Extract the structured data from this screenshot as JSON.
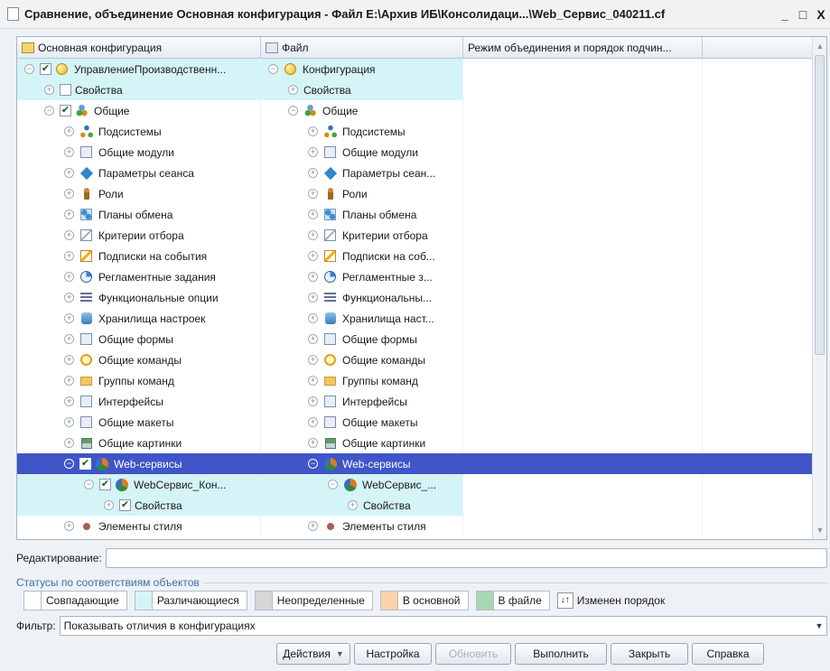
{
  "window": {
    "title": "Сравнение, объединение Основная конфигурация - Файл E:\\Архив ИБ\\Консолидаци...\\Web_Сервис_040211.cf",
    "minimize": "_",
    "maximize": "□",
    "close": "X"
  },
  "grid": {
    "columns": [
      "Основная конфигурация",
      "Файл",
      "Режим объединения и порядок подчин...",
      ""
    ],
    "rows": [
      {
        "indent_main": 0,
        "toggle": "−",
        "check": "checked",
        "icon": "config-icon",
        "main": "УправлениеПроизводственн...",
        "indent_file": 0,
        "file_toggle": "−",
        "file_icon": "config-icon",
        "file": "Конфигурация",
        "state": "diff"
      },
      {
        "indent_main": 1,
        "toggle": "+",
        "check": "unchecked",
        "icon": "",
        "main": "Свойства",
        "indent_file": 1,
        "file_toggle": "+",
        "file_icon": "",
        "file": "Свойства",
        "state": "diff"
      },
      {
        "indent_main": 1,
        "toggle": "−",
        "check": "checked",
        "icon": "common-icon",
        "main": "Общие",
        "indent_file": 1,
        "file_toggle": "−",
        "file_icon": "common-icon",
        "file": "Общие",
        "state": ""
      },
      {
        "indent_main": 2,
        "toggle": "+",
        "check": "",
        "icon": "subsystems-icon",
        "main": "Подсистемы",
        "indent_file": 2,
        "file_toggle": "+",
        "file_icon": "subsystems-icon",
        "file": "Подсистемы",
        "state": ""
      },
      {
        "indent_main": 2,
        "toggle": "+",
        "check": "",
        "icon": "modules-icon",
        "main": "Общие модули",
        "indent_file": 2,
        "file_toggle": "+",
        "file_icon": "modules-icon",
        "file": "Общие модули",
        "state": ""
      },
      {
        "indent_main": 2,
        "toggle": "+",
        "check": "",
        "icon": "session-params-icon",
        "main": "Параметры сеанса",
        "indent_file": 2,
        "file_toggle": "+",
        "file_icon": "session-params-icon",
        "file": "Параметры сеан...",
        "state": ""
      },
      {
        "indent_main": 2,
        "toggle": "+",
        "check": "",
        "icon": "roles-icon",
        "main": "Роли",
        "indent_file": 2,
        "file_toggle": "+",
        "file_icon": "roles-icon",
        "file": "Роли",
        "state": ""
      },
      {
        "indent_main": 2,
        "toggle": "+",
        "check": "",
        "icon": "exchange-plans-icon",
        "main": "Планы обмена",
        "indent_file": 2,
        "file_toggle": "+",
        "file_icon": "exchange-plans-icon",
        "file": "Планы обмена",
        "state": ""
      },
      {
        "indent_main": 2,
        "toggle": "+",
        "check": "",
        "icon": "filter-criteria-icon",
        "main": "Критерии отбора",
        "indent_file": 2,
        "file_toggle": "+",
        "file_icon": "filter-criteria-icon",
        "file": "Критерии отбора",
        "state": ""
      },
      {
        "indent_main": 2,
        "toggle": "+",
        "check": "",
        "icon": "event-subscriptions-icon",
        "main": "Подписки на события",
        "indent_file": 2,
        "file_toggle": "+",
        "file_icon": "event-subscriptions-icon",
        "file": "Подписки на соб...",
        "state": ""
      },
      {
        "indent_main": 2,
        "toggle": "+",
        "check": "",
        "icon": "scheduled-jobs-icon",
        "main": "Регламентные задания",
        "indent_file": 2,
        "file_toggle": "+",
        "file_icon": "scheduled-jobs-icon",
        "file": "Регламентные з...",
        "state": ""
      },
      {
        "indent_main": 2,
        "toggle": "+",
        "check": "",
        "icon": "functional-options-icon",
        "main": "Функциональные опции",
        "indent_file": 2,
        "file_toggle": "+",
        "file_icon": "functional-options-icon",
        "file": "Функциональны...",
        "state": ""
      },
      {
        "indent_main": 2,
        "toggle": "+",
        "check": "",
        "icon": "settings-storage-icon",
        "main": "Хранилища настроек",
        "indent_file": 2,
        "file_toggle": "+",
        "file_icon": "settings-storage-icon",
        "file": "Хранилища наст...",
        "state": ""
      },
      {
        "indent_main": 2,
        "toggle": "+",
        "check": "",
        "icon": "common-forms-icon",
        "main": "Общие формы",
        "indent_file": 2,
        "file_toggle": "+",
        "file_icon": "common-forms-icon",
        "file": "Общие формы",
        "state": ""
      },
      {
        "indent_main": 2,
        "toggle": "+",
        "check": "",
        "icon": "common-commands-icon",
        "main": "Общие команды",
        "indent_file": 2,
        "file_toggle": "+",
        "file_icon": "common-commands-icon",
        "file": "Общие команды",
        "state": ""
      },
      {
        "indent_main": 2,
        "toggle": "+",
        "check": "",
        "icon": "command-groups-icon",
        "main": "Группы команд",
        "indent_file": 2,
        "file_toggle": "+",
        "file_icon": "command-groups-icon",
        "file": "Группы команд",
        "state": ""
      },
      {
        "indent_main": 2,
        "toggle": "+",
        "check": "",
        "icon": "interfaces-icon",
        "main": "Интерфейсы",
        "indent_file": 2,
        "file_toggle": "+",
        "file_icon": "interfaces-icon",
        "file": "Интерфейсы",
        "state": ""
      },
      {
        "indent_main": 2,
        "toggle": "+",
        "check": "",
        "icon": "common-templates-icon",
        "main": "Общие макеты",
        "indent_file": 2,
        "file_toggle": "+",
        "file_icon": "common-templates-icon",
        "file": "Общие макеты",
        "state": ""
      },
      {
        "indent_main": 2,
        "toggle": "+",
        "check": "",
        "icon": "common-pictures-icon",
        "main": "Общие картинки",
        "indent_file": 2,
        "file_toggle": "+",
        "file_icon": "common-pictures-icon",
        "file": "Общие картинки",
        "state": ""
      },
      {
        "indent_main": 2,
        "toggle": "−",
        "check": "checked",
        "icon": "web-services-icon",
        "main": "Web-сервисы",
        "indent_file": 2,
        "file_toggle": "−",
        "file_icon": "web-services-icon",
        "file": "Web-сервисы",
        "state": "sel"
      },
      {
        "indent_main": 3,
        "toggle": "−",
        "check": "checked",
        "icon": "web-service-icon",
        "main": "WebСервис_Кон...",
        "indent_file": 3,
        "file_toggle": "−",
        "file_icon": "web-service-icon",
        "file": "WebСервис_...",
        "state": "diff"
      },
      {
        "indent_main": 4,
        "toggle": "+",
        "check": "checked",
        "icon": "",
        "main": "Свойства",
        "indent_file": 4,
        "file_toggle": "+",
        "file_icon": "",
        "file": "Свойства",
        "state": "diff"
      },
      {
        "indent_main": 2,
        "toggle": "+",
        "check": "",
        "icon": "style-elements-icon",
        "main": "Элементы стиля",
        "indent_file": 2,
        "file_toggle": "+",
        "file_icon": "style-elements-icon",
        "file": "Элементы стиля",
        "state": ""
      }
    ]
  },
  "editing": {
    "label": "Редактирование:",
    "value": ""
  },
  "legend": {
    "title": "Статусы по соответствиям объектов",
    "items": [
      {
        "label": "Совпадающие",
        "color": "#ffffff"
      },
      {
        "label": "Различающиеся",
        "color": "#d4f4f7"
      },
      {
        "label": "Неопределенные",
        "color": "#d6d6d6"
      },
      {
        "label": "В основной",
        "color": "#fbd3a8"
      },
      {
        "label": "В файле",
        "color": "#a6d8b2"
      }
    ],
    "order_changed": {
      "label": "Изменен порядок",
      "icon": "order-changed-icon",
      "glyph": "↓↑"
    }
  },
  "filter": {
    "label": "Фильтр:",
    "value": "Показывать отличия в конфигурациях"
  },
  "buttons": [
    {
      "label": "Действия",
      "enabled": true,
      "dropdown": true
    },
    {
      "label": "Настройка",
      "enabled": true
    },
    {
      "label": "Обновить",
      "enabled": false
    },
    {
      "label": "Выполнить",
      "enabled": true
    },
    {
      "label": "Закрыть",
      "enabled": true
    },
    {
      "label": "Справка",
      "enabled": true
    }
  ],
  "colors": {
    "selection": "#3f55c8",
    "diff": "#d4f4f7",
    "legend_title": "#3e6fa8"
  }
}
